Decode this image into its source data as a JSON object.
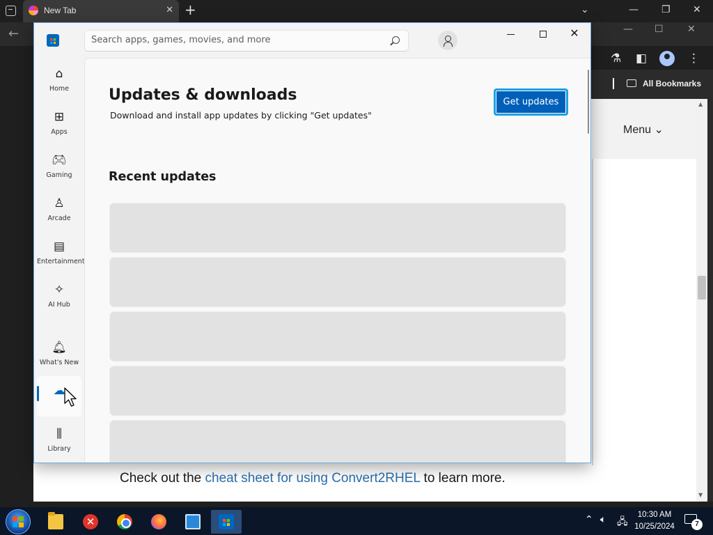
{
  "browser": {
    "tab_title": "New Tab",
    "tab_close": "✕",
    "new_tab": "+",
    "menu_label": "Menu ⌄",
    "bookmarks_label": "All Bookmarks",
    "page_text_before": "Check out the ",
    "page_link": "cheat sheet for using Convert2RHEL",
    "page_text_after": " to learn more."
  },
  "store": {
    "search_placeholder": "Search apps, games, movies, and more",
    "title": "Updates & downloads",
    "subtitle": "Download and install app updates by clicking \"Get updates\"",
    "get_updates_label": "Get updates",
    "section_title": "Recent updates",
    "nav": {
      "home": "Home",
      "apps": "Apps",
      "gaming": "Gaming",
      "arcade": "Arcade",
      "entertainment": "Entertainment",
      "ai_hub": "AI Hub",
      "whats_new": "What's New",
      "library": "Library"
    },
    "skeleton_rows": 5
  },
  "taskbar": {
    "time": "10:30 AM",
    "date": "10/25/2024",
    "notification_count": "7"
  },
  "colors": {
    "accent": "#005fb8",
    "focus_ring": "#1ba1e2",
    "link": "#2a6fb0",
    "taskbar": "#0b1628"
  }
}
